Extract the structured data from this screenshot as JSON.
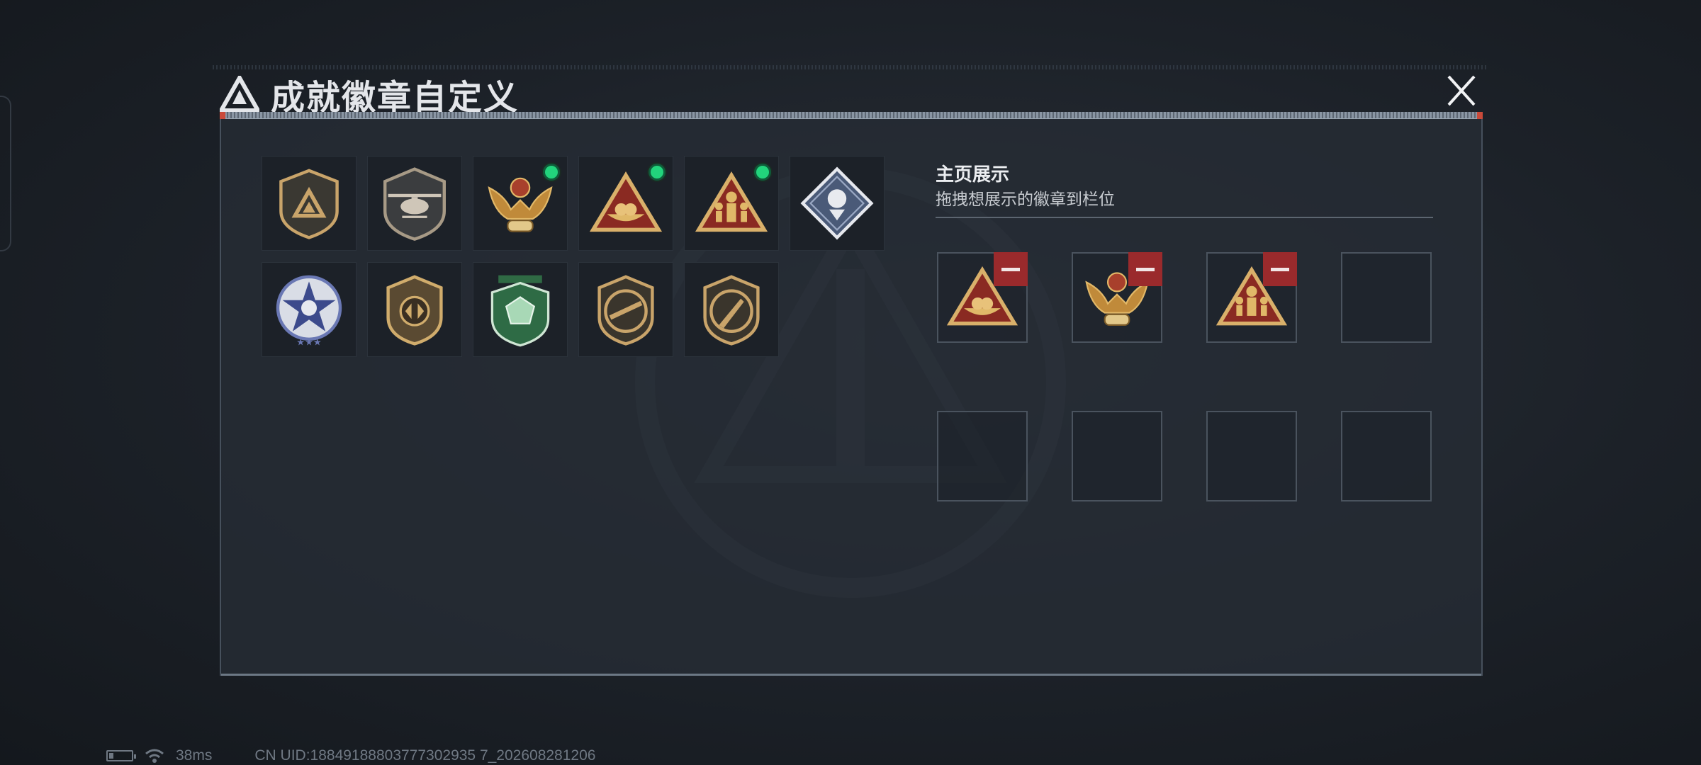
{
  "header": {
    "title": "成就徽章自定义"
  },
  "collection": {
    "badges": [
      {
        "icon": "shield-triangle-badge-icon",
        "equipped": false
      },
      {
        "icon": "helicopter-shield-badge-icon",
        "equipped": false
      },
      {
        "icon": "phoenix-eagle-badge-icon",
        "equipped": true
      },
      {
        "icon": "triangle-bowl-badge-icon",
        "equipped": true
      },
      {
        "icon": "triangle-soldiers-badge-icon",
        "equipped": true
      },
      {
        "icon": "diamond-rose-badge-icon",
        "equipped": false
      },
      {
        "icon": "star-skull-badge-icon",
        "equipped": false
      },
      {
        "icon": "shield-wings-badge-icon",
        "equipped": false
      },
      {
        "icon": "green-gem-badge-icon",
        "equipped": false
      },
      {
        "icon": "rifle-shield-badge-icon",
        "equipped": false
      },
      {
        "icon": "knife-shield-badge-icon",
        "equipped": false
      }
    ]
  },
  "display": {
    "title": "主页展示",
    "subtitle": "拖拽想展示的徽章到栏位",
    "slots": [
      {
        "icon": "triangle-bowl-badge-icon"
      },
      {
        "icon": "phoenix-eagle-badge-icon"
      },
      {
        "icon": "triangle-soldiers-badge-icon"
      },
      {
        "icon": null
      },
      {
        "icon": null
      },
      {
        "icon": null
      },
      {
        "icon": null
      },
      {
        "icon": null
      }
    ]
  },
  "status": {
    "ping": "38ms",
    "uid": "CN UID:18849188803777302935 7_202608281206"
  },
  "colors": {
    "equipped_dot": "#22d47c",
    "remove_button": "#9a2a2c",
    "badge_gold": "#c9a46a",
    "panel_bg": "#262c34"
  }
}
